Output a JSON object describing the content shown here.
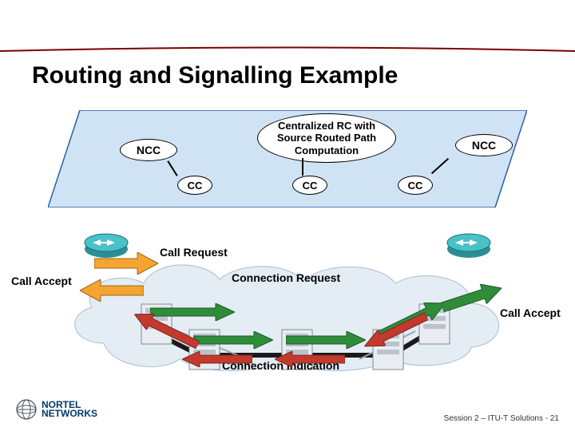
{
  "title": "Routing and Signalling Example",
  "control_plane": {
    "ncc_left": "NCC",
    "ncc_right": "NCC",
    "rc": "Centralized RC with Source Routed Path Computation",
    "cc1": "CC",
    "cc2": "CC",
    "cc3": "CC"
  },
  "labels": {
    "call_request": "Call Request",
    "connection_request": "Connection Request",
    "call_accept_left": "Call Accept",
    "call_accept_right": "Call Accept",
    "connection_indication": "Connection Indication"
  },
  "footer": "Session 2 – ITU-T Solutions - 21",
  "logo": {
    "line1": "NORTEL",
    "line2": "NETWORKS"
  },
  "colors": {
    "blue_light": "#cfe3f5",
    "blue_mid": "#3f6fae",
    "orange": "#f6a431",
    "red": "#c23a2e",
    "green": "#2f8d3a",
    "teal": "#2a8f95"
  }
}
